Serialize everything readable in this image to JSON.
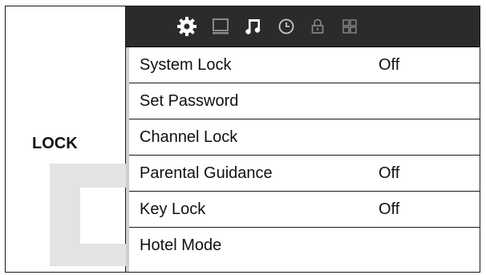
{
  "section": {
    "title": "LOCK"
  },
  "icon_bar": {
    "icons": [
      "gear-icon",
      "monitor-icon",
      "music-note-icon",
      "clock-icon",
      "lock-icon",
      "grid-apps-icon"
    ],
    "active": "gear-icon",
    "colors": {
      "background": "#2b2b2b",
      "active": "#ffffff",
      "inactive": "#8a8a8a"
    }
  },
  "menu": {
    "items": [
      {
        "label": "System Lock",
        "value": "Off"
      },
      {
        "label": "Set Password",
        "value": ""
      },
      {
        "label": "Channel Lock",
        "value": ""
      },
      {
        "label": "Parental Guidance",
        "value": "Off"
      },
      {
        "label": "Key Lock",
        "value": "Off"
      },
      {
        "label": "Hotel Mode",
        "value": ""
      }
    ]
  }
}
